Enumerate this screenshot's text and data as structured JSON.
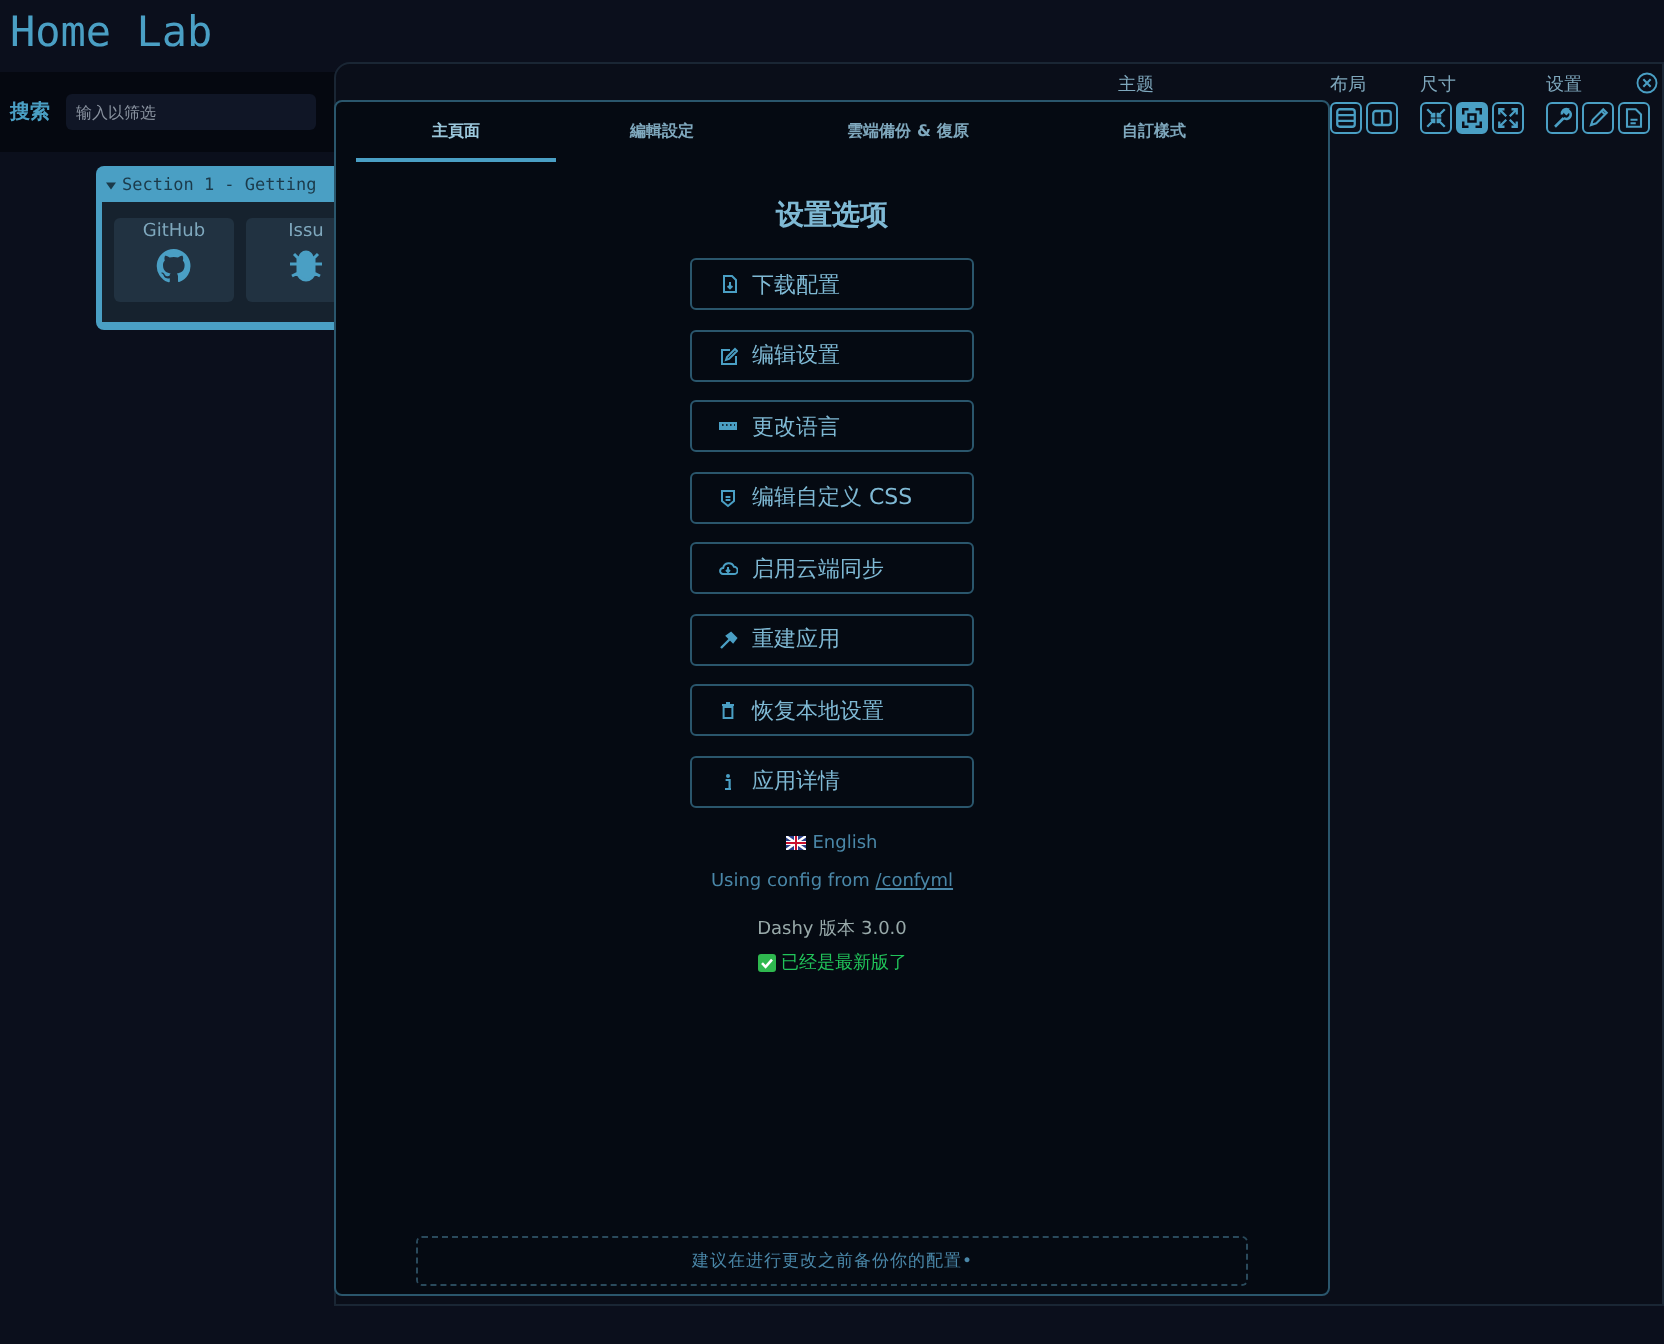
{
  "header": {
    "title": "Home Lab"
  },
  "search": {
    "label": "搜索",
    "placeholder": "输入以筛选"
  },
  "section": {
    "title": "Section 1 - Getting",
    "expanded": true,
    "items": [
      {
        "kind": "github",
        "label": "GitHub"
      },
      {
        "kind": "bug",
        "label": "Issu"
      }
    ]
  },
  "toolbar": {
    "groups": [
      {
        "label": "主题"
      },
      {
        "label": "布局",
        "buttons": [
          {
            "kind": "list",
            "selected": false
          },
          {
            "kind": "columns",
            "selected": false
          }
        ]
      },
      {
        "label": "尺寸",
        "buttons": [
          {
            "kind": "shrink",
            "selected": false
          },
          {
            "kind": "fit",
            "selected": true
          },
          {
            "kind": "expand",
            "selected": false
          }
        ]
      },
      {
        "label": "设置",
        "buttons": [
          {
            "kind": "wrench",
            "selected": false
          },
          {
            "kind": "pen",
            "selected": false
          },
          {
            "kind": "config",
            "selected": false
          }
        ]
      }
    ]
  },
  "modal": {
    "tabs": [
      {
        "label": "主頁面",
        "selected": true
      },
      {
        "label": "編輯設定",
        "selected": false
      },
      {
        "label": "雲端備份 & 復原",
        "selected": false
      },
      {
        "label": "自訂樣式",
        "selected": false
      }
    ],
    "heading": "设置选项",
    "actions": [
      {
        "kind": "file",
        "label": "下载配置"
      },
      {
        "kind": "edit",
        "label": "编辑设置"
      },
      {
        "kind": "keyboard",
        "label": "更改语言"
      },
      {
        "kind": "shield",
        "label": "编辑自定义 CSS"
      },
      {
        "kind": "cloud",
        "label": "启用云端同步"
      },
      {
        "kind": "hammer",
        "label": "重建应用"
      },
      {
        "kind": "trash",
        "label": "恢复本地设置"
      },
      {
        "kind": "info",
        "label": "应用详情"
      }
    ],
    "language": "English",
    "config_note": {
      "text": "Using config from",
      "link": "/confyml"
    },
    "version": "Dashy 版本 3.0.0",
    "update_status": "已经是最新版了",
    "footer_note": "建议在进行更改之前备份你的配置•"
  }
}
